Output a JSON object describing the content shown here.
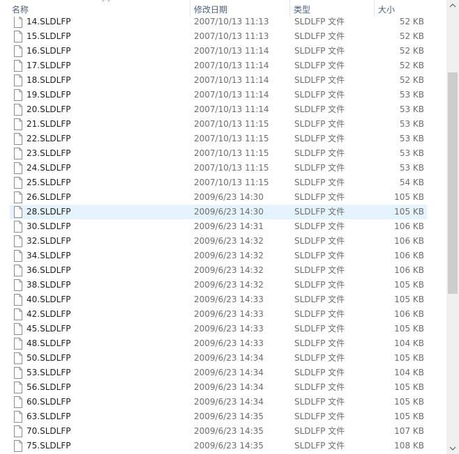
{
  "columns": {
    "name": "名称",
    "date": "修改日期",
    "type": "类型",
    "size": "大小"
  },
  "files": [
    {
      "name": "14.SLDLFP",
      "date": "2007/10/13 11:13",
      "type": "SLDLFP 文件",
      "size": "52 KB"
    },
    {
      "name": "15.SLDLFP",
      "date": "2007/10/13 11:13",
      "type": "SLDLFP 文件",
      "size": "52 KB"
    },
    {
      "name": "16.SLDLFP",
      "date": "2007/10/13 11:14",
      "type": "SLDLFP 文件",
      "size": "52 KB"
    },
    {
      "name": "17.SLDLFP",
      "date": "2007/10/13 11:14",
      "type": "SLDLFP 文件",
      "size": "52 KB"
    },
    {
      "name": "18.SLDLFP",
      "date": "2007/10/13 11:14",
      "type": "SLDLFP 文件",
      "size": "52 KB"
    },
    {
      "name": "19.SLDLFP",
      "date": "2007/10/13 11:14",
      "type": "SLDLFP 文件",
      "size": "53 KB"
    },
    {
      "name": "20.SLDLFP",
      "date": "2007/10/13 11:14",
      "type": "SLDLFP 文件",
      "size": "53 KB"
    },
    {
      "name": "21.SLDLFP",
      "date": "2007/10/13 11:15",
      "type": "SLDLFP 文件",
      "size": "53 KB"
    },
    {
      "name": "22.SLDLFP",
      "date": "2007/10/13 11:15",
      "type": "SLDLFP 文件",
      "size": "53 KB"
    },
    {
      "name": "23.SLDLFP",
      "date": "2007/10/13 11:15",
      "type": "SLDLFP 文件",
      "size": "53 KB"
    },
    {
      "name": "24.SLDLFP",
      "date": "2007/10/13 11:15",
      "type": "SLDLFP 文件",
      "size": "53 KB"
    },
    {
      "name": "25.SLDLFP",
      "date": "2007/10/13 11:15",
      "type": "SLDLFP 文件",
      "size": "54 KB"
    },
    {
      "name": "26.SLDLFP",
      "date": "2009/6/23 14:30",
      "type": "SLDLFP 文件",
      "size": "105 KB"
    },
    {
      "name": "28.SLDLFP",
      "date": "2009/6/23 14:30",
      "type": "SLDLFP 文件",
      "size": "105 KB",
      "selected": true
    },
    {
      "name": "30.SLDLFP",
      "date": "2009/6/23 14:31",
      "type": "SLDLFP 文件",
      "size": "106 KB"
    },
    {
      "name": "32.SLDLFP",
      "date": "2009/6/23 14:32",
      "type": "SLDLFP 文件",
      "size": "106 KB"
    },
    {
      "name": "34.SLDLFP",
      "date": "2009/6/23 14:32",
      "type": "SLDLFP 文件",
      "size": "106 KB"
    },
    {
      "name": "36.SLDLFP",
      "date": "2009/6/23 14:32",
      "type": "SLDLFP 文件",
      "size": "106 KB"
    },
    {
      "name": "38.SLDLFP",
      "date": "2009/6/23 14:32",
      "type": "SLDLFP 文件",
      "size": "105 KB"
    },
    {
      "name": "40.SLDLFP",
      "date": "2009/6/23 14:33",
      "type": "SLDLFP 文件",
      "size": "105 KB"
    },
    {
      "name": "42.SLDLFP",
      "date": "2009/6/23 14:33",
      "type": "SLDLFP 文件",
      "size": "106 KB"
    },
    {
      "name": "45.SLDLFP",
      "date": "2009/6/23 14:33",
      "type": "SLDLFP 文件",
      "size": "105 KB"
    },
    {
      "name": "48.SLDLFP",
      "date": "2009/6/23 14:33",
      "type": "SLDLFP 文件",
      "size": "104 KB"
    },
    {
      "name": "50.SLDLFP",
      "date": "2009/6/23 14:34",
      "type": "SLDLFP 文件",
      "size": "105 KB"
    },
    {
      "name": "53.SLDLFP",
      "date": "2009/6/23 14:34",
      "type": "SLDLFP 文件",
      "size": "104 KB"
    },
    {
      "name": "56.SLDLFP",
      "date": "2009/6/23 14:34",
      "type": "SLDLFP 文件",
      "size": "105 KB"
    },
    {
      "name": "60.SLDLFP",
      "date": "2009/6/23 14:34",
      "type": "SLDLFP 文件",
      "size": "105 KB"
    },
    {
      "name": "63.SLDLFP",
      "date": "2009/6/23 14:35",
      "type": "SLDLFP 文件",
      "size": "105 KB"
    },
    {
      "name": "70.SLDLFP",
      "date": "2009/6/23 14:35",
      "type": "SLDLFP 文件",
      "size": "107 KB"
    },
    {
      "name": "75.SLDLFP",
      "date": "2009/6/23 14:35",
      "type": "SLDLFP 文件",
      "size": "108 KB"
    }
  ],
  "icons": {
    "file": "file-icon",
    "sort": "sort-ascending-icon",
    "scroll_up": "scroll-up-arrow-icon",
    "scroll_down": "scroll-down-arrow-icon"
  },
  "colors": {
    "selection": "#e5f3ff",
    "header_text": "#4c607a"
  }
}
